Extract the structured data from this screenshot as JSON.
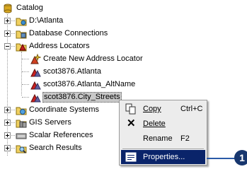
{
  "tree": {
    "root": "Catalog",
    "items": [
      {
        "label": "D:\\Atlanta"
      },
      {
        "label": "Database Connections"
      },
      {
        "label": "Address Locators",
        "children": [
          {
            "label": "Create New Address Locator"
          },
          {
            "label": "scot3876.Atlanta"
          },
          {
            "label": "scot3876.Atlanta_AltName"
          },
          {
            "label": "scot3876.City_Streets"
          }
        ]
      },
      {
        "label": "Coordinate Systems"
      },
      {
        "label": "GIS Servers"
      },
      {
        "label": "Scalar References"
      },
      {
        "label": "Search Results"
      }
    ]
  },
  "context_menu": {
    "copy": {
      "label": "Copy",
      "shortcut": "Ctrl+C"
    },
    "delete": {
      "label": "Delete"
    },
    "rename": {
      "label": "Rename",
      "shortcut": "F2"
    },
    "properties": {
      "label": "Properties..."
    }
  },
  "callout": {
    "number": "1"
  },
  "colors": {
    "highlight": "#0a246a",
    "callout": "#17366e",
    "accent_line": "#2a5aa8"
  }
}
